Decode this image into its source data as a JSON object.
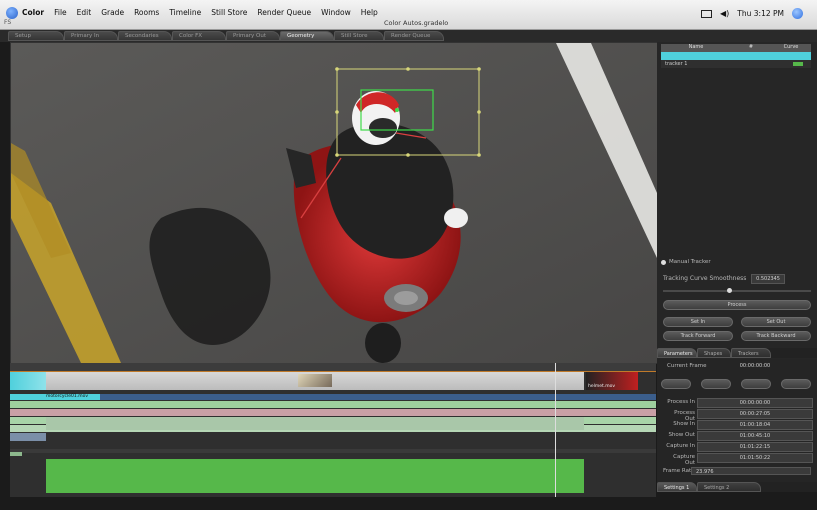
{
  "menubar": {
    "app_name": "Color",
    "menus": [
      "File",
      "Edit",
      "Grade",
      "Rooms",
      "Timeline",
      "Still Store",
      "Render Queue",
      "Window",
      "Help"
    ],
    "window_title": "Color Autos.gradelo",
    "sub_label": "FS",
    "clock": "Thu 3:12 PM"
  },
  "room_tabs": [
    {
      "label": "Setup",
      "active": false
    },
    {
      "label": "Primary In",
      "active": false
    },
    {
      "label": "Secondaries",
      "active": false
    },
    {
      "label": "Color FX",
      "active": false
    },
    {
      "label": "Primary Out",
      "active": false
    },
    {
      "label": "Geometry",
      "active": true
    },
    {
      "label": "Still Store",
      "active": false
    },
    {
      "label": "Render Queue",
      "active": false
    }
  ],
  "tracker_list": {
    "columns": [
      "Name",
      "#",
      "Curve"
    ],
    "rows": [
      {
        "name": "tracker 1",
        "num": "",
        "curve": "green"
      }
    ]
  },
  "tracking_panel": {
    "manual_tracker_label": "Manual Tracker",
    "sensitivity_label": "Tracking Curve Smoothness",
    "sensitivity_value": "0.502345",
    "sensitivity_slider": 0.45,
    "buttons": [
      "Process",
      "Set In",
      "Set Out",
      "Track Forward",
      "Track Backward"
    ]
  },
  "panel_tabs": [
    {
      "label": "Parameters",
      "active": true
    },
    {
      "label": "Shapes",
      "active": false
    },
    {
      "label": "Trackers",
      "active": false
    }
  ],
  "params": {
    "current_frame_label": "Current Frame",
    "current_frame_value": "00:00:00:00",
    "small_buttons": [
      "",
      "",
      "",
      ""
    ],
    "fields": [
      {
        "label": "Process In",
        "value": "00:00:00:00"
      },
      {
        "label": "Process Out",
        "value": "00:00:27:05"
      },
      {
        "label": "Show In",
        "value": "01:00:18:04"
      },
      {
        "label": "Show Out",
        "value": "01:00:45:10"
      },
      {
        "label": "Capture In",
        "value": "01:01:22:15"
      },
      {
        "label": "Capture Out",
        "value": "01:01:50:22"
      }
    ],
    "frame_rate_label": "Frame Rate",
    "frame_rate_value": "23.976"
  },
  "bottom_tabs": [
    {
      "label": "Settings 1",
      "active": true
    },
    {
      "label": "Settings 2",
      "active": false
    }
  ],
  "timeline": {
    "clip_label": "motorcycle01.mov",
    "clip_label_2": "helmet.mov"
  },
  "colors": {
    "accent": "#4fd0dc",
    "track_green": "#56b84a",
    "tracker_yellow": "#d8d77a",
    "tracker_green": "#3fdc4a"
  }
}
